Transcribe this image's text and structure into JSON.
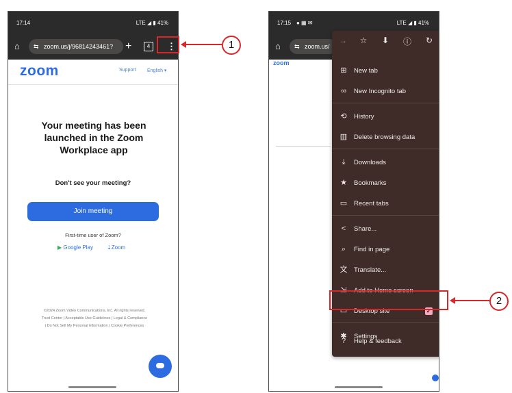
{
  "left_phone": {
    "status_time": "17:14",
    "status_right": "LTE ◢ ▮ 41%",
    "url": "zoom.us/j/96814243461?",
    "tab_count": "4",
    "logo": "zoom",
    "support_link": "Support",
    "language_link": "English ▾",
    "headline": "Your meeting has been launched in the Zoom Workplace app",
    "dont_see": "Don't see your meeting?",
    "join_button": "Join meeting",
    "first_time": "First-time user of Zoom?",
    "google_play": "Google Play",
    "zoom_download": "Zoom",
    "footer_line1": "©2024 Zoom Video Communications, Inc. All rights reserved.",
    "footer_line2": "Trust Center | Acceptable Use Guidelines | Legal & Compliance",
    "footer_line3": "| Do Not Sell My Personal Information | Cookie Preferences"
  },
  "right_phone": {
    "status_time": "17:15",
    "status_right": "LTE ◢ ▮ 41%",
    "url": "zoom.us/",
    "logo": "zoom",
    "menu_items": [
      {
        "label": "New tab",
        "icon": "plus-square-icon"
      },
      {
        "label": "New Incognito tab",
        "icon": "incognito-icon"
      },
      {
        "label": "History",
        "icon": "history-icon"
      },
      {
        "label": "Delete browsing data",
        "icon": "trash-icon"
      },
      {
        "label": "Downloads",
        "icon": "download-icon"
      },
      {
        "label": "Bookmarks",
        "icon": "star-icon"
      },
      {
        "label": "Recent tabs",
        "icon": "devices-icon"
      },
      {
        "label": "Share...",
        "icon": "share-icon"
      },
      {
        "label": "Find in page",
        "icon": "find-icon"
      },
      {
        "label": "Translate...",
        "icon": "translate-icon"
      },
      {
        "label": "Add to Home screen",
        "icon": "add-home-icon"
      },
      {
        "label": "Desktop site",
        "icon": "desktop-icon",
        "checked": true
      },
      {
        "label": "Settings",
        "icon": "gear-icon"
      },
      {
        "label": "Help & feedback",
        "icon": "help-icon"
      }
    ]
  },
  "callouts": {
    "step1": "1",
    "step2": "2"
  },
  "colors": {
    "zoom_blue": "#2D6CE0",
    "menu_bg": "#3f2c29",
    "highlight_red": "#d6282b",
    "check_pink": "#f4a9c0"
  }
}
